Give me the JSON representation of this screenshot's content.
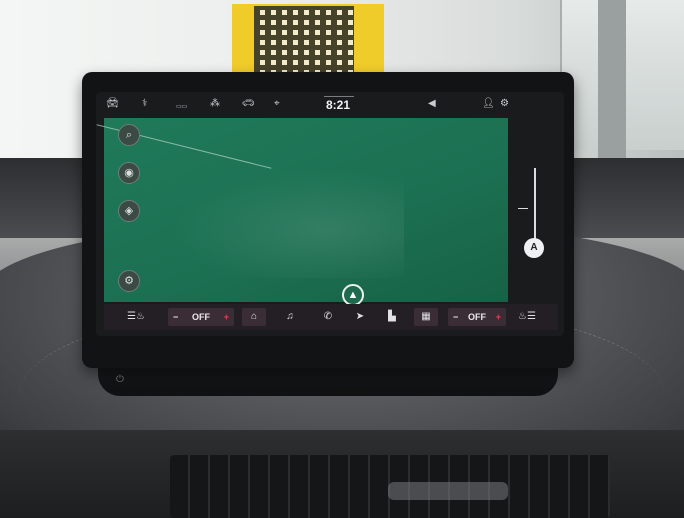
{
  "status_bar": {
    "icons": [
      "car-icon",
      "assist-icon",
      "sport-mode-icon",
      "drive-icon",
      "vehicle-icon",
      "location-icon",
      "volume-icon",
      "profile-icon",
      "settings-icon"
    ],
    "clock": "8:21"
  },
  "map": {
    "side_buttons": [
      "search-icon",
      "voice-icon",
      "layers-icon",
      "settings-icon"
    ],
    "compass_label": "A"
  },
  "climate": {
    "left": {
      "minus": "−",
      "value": "OFF",
      "plus": "+"
    },
    "right": {
      "minus": "−",
      "value": "OFF",
      "plus": "+"
    }
  },
  "bottom_bar": {
    "items": [
      "seat-heat-left-icon",
      "home-icon",
      "music-icon",
      "phone-icon",
      "navigation-icon",
      "apps-icon",
      "grid-icon",
      "seat-heat-right-icon"
    ]
  },
  "colors": {
    "map_green": "#1c6f52",
    "bar_background": "#231f24",
    "plus_red": "#e04256"
  }
}
